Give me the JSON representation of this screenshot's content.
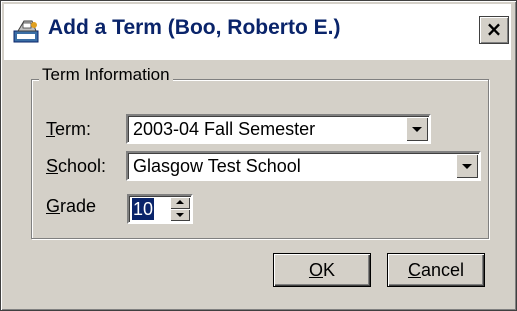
{
  "window": {
    "title": "Add a Term (Boo, Roberto E.)",
    "close_glyph": "×"
  },
  "group": {
    "legend": "Term Information"
  },
  "fields": {
    "term": {
      "label_mnemonic": "T",
      "label_rest": "erm:",
      "value": "2003-04 Fall Semester"
    },
    "school": {
      "label_mnemonic": "S",
      "label_rest": "chool:",
      "value": "Glasgow Test School"
    },
    "grade": {
      "label_mnemonic": "G",
      "label_rest": "rade",
      "value": "10"
    }
  },
  "buttons": {
    "ok": {
      "mnemonic": "O",
      "rest": "K"
    },
    "cancel": {
      "mnemonic": "C",
      "rest": "ancel"
    }
  },
  "colors": {
    "face": "#d4d0c8",
    "title_text": "#0a246a",
    "selection": "#0a246a"
  },
  "icons": [
    "app-dialog-icon",
    "close-icon",
    "dropdown-arrow-icon",
    "spin-up-icon",
    "spin-down-icon"
  ]
}
